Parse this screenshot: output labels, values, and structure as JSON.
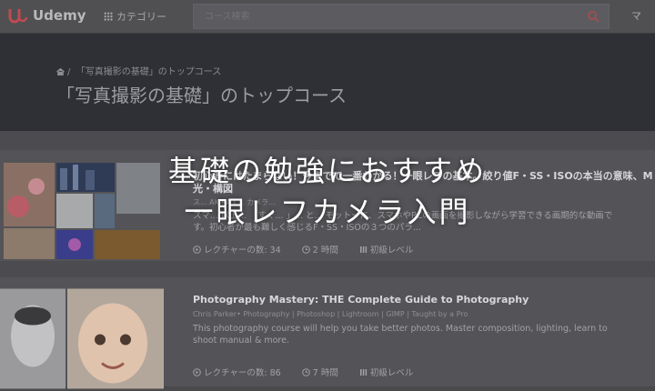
{
  "topbar": {
    "brand": "Udemy",
    "category_label": "カテゴリー",
    "search_placeholder": "コース検索",
    "right_label": "マ"
  },
  "hero": {
    "breadcrumb": "「写真撮影の基礎」のトップコース",
    "title": "「写真撮影の基礎」のトップコース"
  },
  "overlay": {
    "line1": "基礎の勉強におすすめ",
    "line2": "一眼レフカメラ入門"
  },
  "courses": [
    {
      "title_line1": "初心者にはたまらない！今までで一番わかる！一眼レフの基本。絞り値F・SS・ISOの本当の意味、M",
      "title_line2": "光・構図",
      "meta": "ス... AKIRA  L... カメラ...",
      "desc": "スマ... 以上... 「すぐ... 」... と... モットーに、スマホやPCの画面を撮影しながら学習できる画期的な動画です。初心者が最も難しく感じるF・SS・ISOの３つのパラ...",
      "lectures": "レクチャーの数: 34",
      "duration": "2 時間",
      "level": "初級レベル"
    },
    {
      "title": "Photography Mastery: THE Complete Guide to Photography",
      "meta": "Chris Parker• Photography | Photoshop | Lightroom | GIMP | Taught by a Pro",
      "desc": "This photography course will help you take better photos. Master composition, lighting, learn to shoot manual & more.",
      "lectures": "レクチャーの数: 86",
      "duration": "7 時間",
      "level": "初級レベル"
    }
  ],
  "colors": {
    "brand": "#c04a52",
    "hero_bg": "#2f3035",
    "search_icon": "#b24a4a"
  }
}
